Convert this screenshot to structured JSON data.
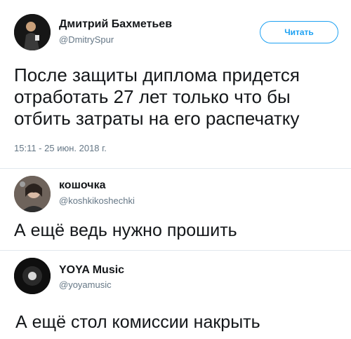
{
  "tweet1": {
    "author_name": "Дмитрий Бахметьев",
    "handle": "@DmitrySpur",
    "follow_label": "Читать",
    "text_lines": [
      "После защиты диплома придется",
      "отработать 27 лет только что бы",
      "отбить затраты на его распечатку"
    ],
    "timestamp": "15:11 - 25 июн. 2018 г."
  },
  "reply1": {
    "author_name": "кошочка",
    "handle": "@koshkikoshechki",
    "text": "А ещё ведь нужно прошить"
  },
  "reply2": {
    "author_name": "YOYA Music",
    "handle": "@yoyamusic",
    "text": "А ещё стол комиссии накрыть"
  }
}
